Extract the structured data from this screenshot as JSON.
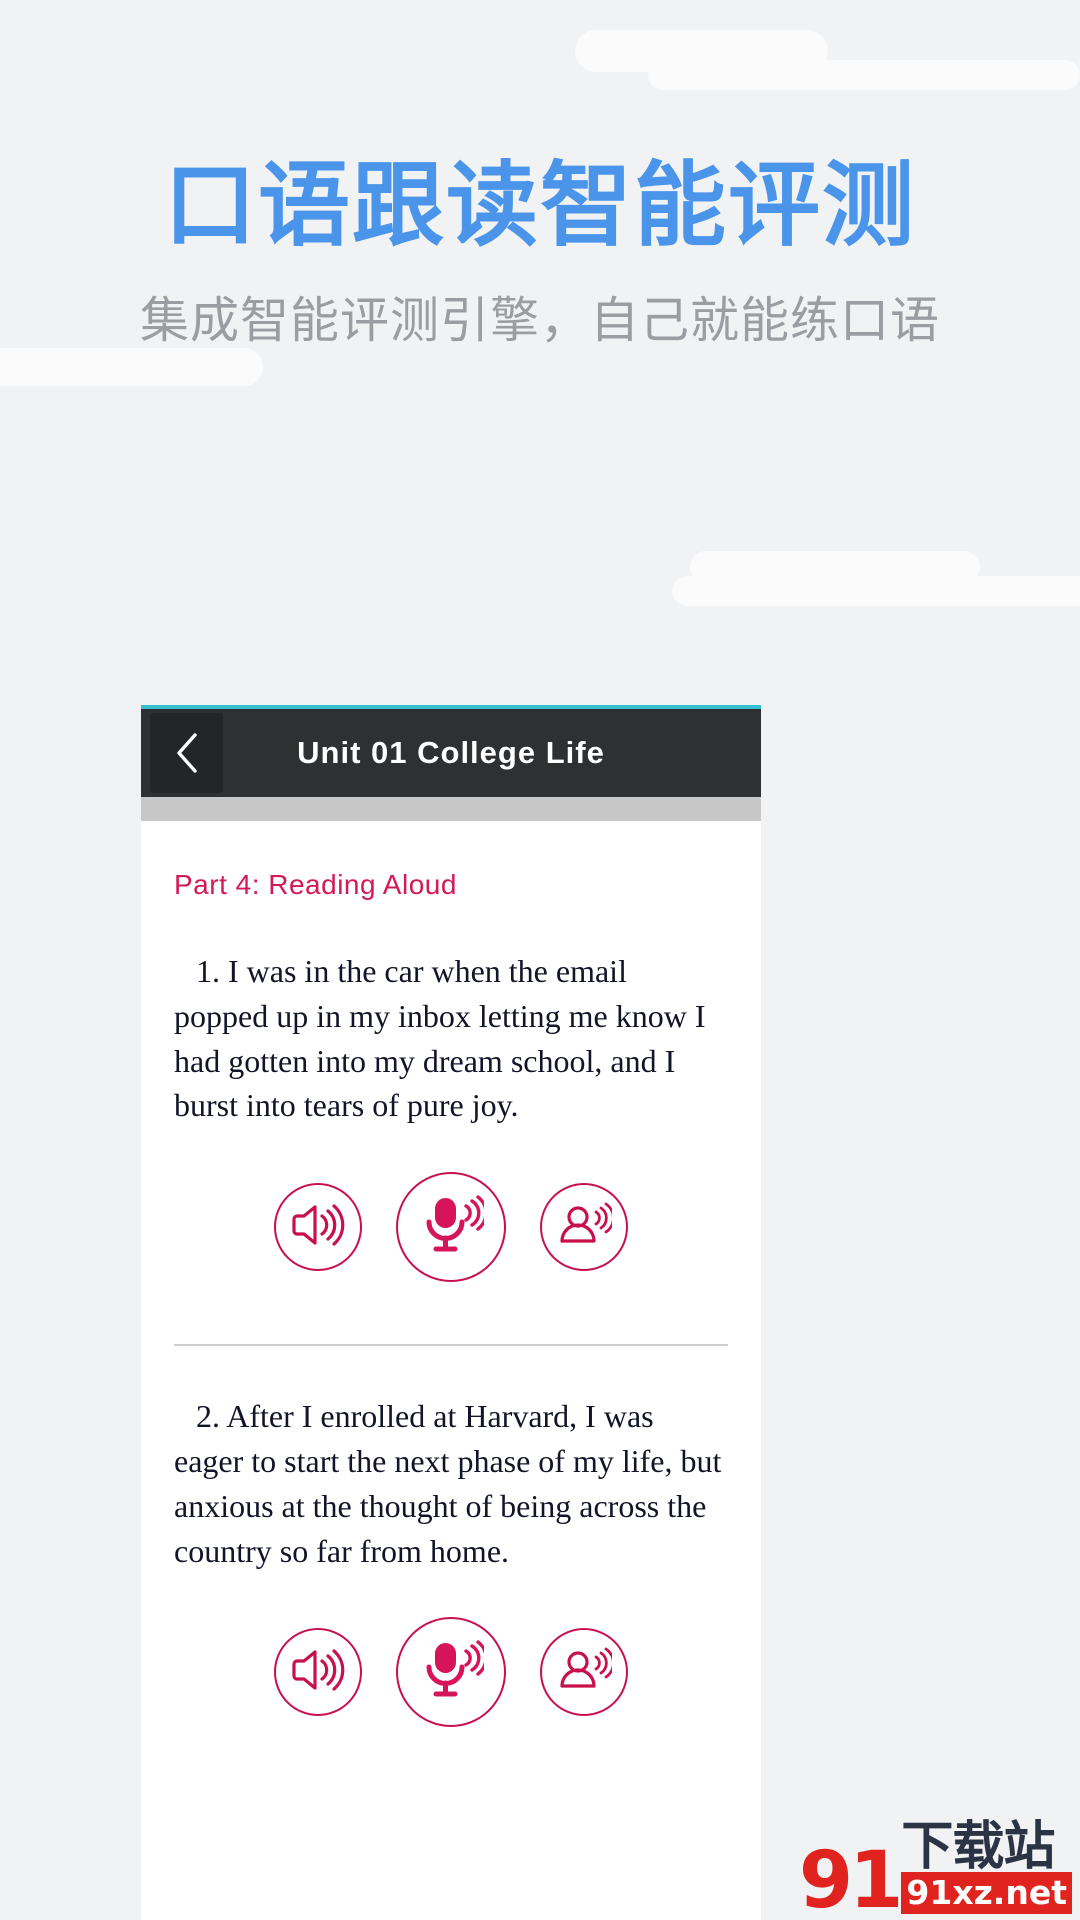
{
  "promo": {
    "title": "口语跟读智能评测",
    "subtitle": "集成智能评测引擎，自己就能练口语",
    "title_color": "#4a95ea",
    "subtitle_color": "#9a9ea3",
    "background_color": "#f1f2f4"
  },
  "app": {
    "accent_top_color": "#35c0d2",
    "navbar_color": "#2f3032",
    "nav_title": "Unit 01 College Life",
    "back_icon": "chevron-left-icon",
    "section_label": "Part 4: Reading Aloud",
    "section_color": "#d31a55",
    "button_color": "#c8104a",
    "items": [
      {
        "number": "1.",
        "text": "1. I was in the car when the email popped up in my inbox letting me know I had gotten into my dream school, and I burst into tears of pure joy.",
        "buttons": [
          {
            "name": "play-model-audio-button",
            "icon": "speaker-icon"
          },
          {
            "name": "record-button",
            "icon": "microphone-icon"
          },
          {
            "name": "play-my-recording-button",
            "icon": "user-sound-icon"
          }
        ]
      },
      {
        "number": "2.",
        "text": "2. After I enrolled at Harvard, I was eager to start the next phase of my life, but anxious at the thought of being across the country so far from home.",
        "buttons": [
          {
            "name": "play-model-audio-button",
            "icon": "speaker-icon"
          },
          {
            "name": "record-button",
            "icon": "microphone-icon"
          },
          {
            "name": "play-my-recording-button",
            "icon": "user-sound-icon"
          }
        ]
      }
    ]
  },
  "watermark": {
    "mark": "91",
    "cn": "下载站",
    "url": "91xz.net",
    "color": "#e0231f",
    "cn_color": "#2b3445"
  }
}
